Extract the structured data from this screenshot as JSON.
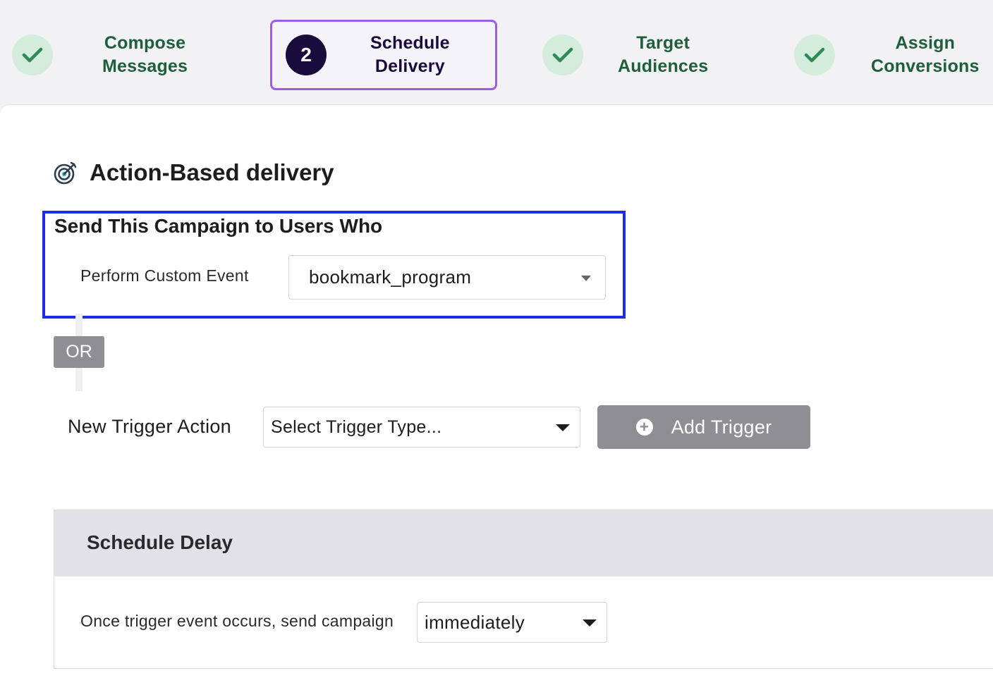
{
  "stepper": {
    "steps": [
      {
        "line1": "Compose",
        "line2": "Messages",
        "state": "done",
        "icon": "check-icon"
      },
      {
        "number": "2",
        "line1": "Schedule",
        "line2": "Delivery",
        "state": "active"
      },
      {
        "line1": "Target",
        "line2": "Audiences",
        "state": "done",
        "icon": "check-icon"
      },
      {
        "line1": "Assign",
        "line2": "Conversions",
        "state": "done",
        "icon": "check-icon"
      }
    ]
  },
  "delivery": {
    "title": "Action-Based delivery",
    "icon": "target-icon",
    "subheading": "Send This Campaign to Users Who",
    "custom_event_label": "Perform Custom Event",
    "custom_event_value": "bookmark_program",
    "or_label": "OR",
    "new_trigger_label": "New Trigger Action",
    "trigger_type_value": "Select Trigger Type...",
    "add_trigger_label": "Add Trigger"
  },
  "schedule_delay": {
    "title": "Schedule Delay",
    "send_label": "Once trigger event occurs, send campaign",
    "send_value": "immediately"
  },
  "colors": {
    "step_done_bg": "#d3ecdc",
    "step_done_text": "#1e5e3c",
    "step_active_border": "#9b5de5",
    "step_active_bg": "#1a0b3d",
    "highlight_border": "#1f2de0",
    "disabled_button": "#8e8e93"
  }
}
